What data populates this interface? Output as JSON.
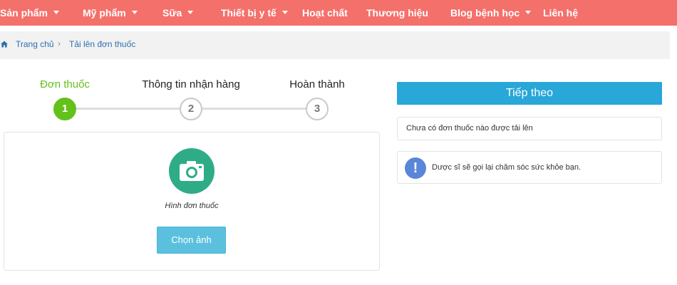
{
  "nav": {
    "items": [
      {
        "label": "Sản phẩm",
        "has_dropdown": true
      },
      {
        "label": "Mỹ phẩm",
        "has_dropdown": true
      },
      {
        "label": "Sữa",
        "has_dropdown": true
      },
      {
        "label": "Thiết bị y tế",
        "has_dropdown": true
      },
      {
        "label": "Hoạt chất",
        "has_dropdown": false
      },
      {
        "label": "Thương hiệu",
        "has_dropdown": false
      },
      {
        "label": "Blog bệnh học",
        "has_dropdown": true
      },
      {
        "label": "Liên hệ",
        "has_dropdown": false
      }
    ]
  },
  "breadcrumb": {
    "home_icon": "home-icon",
    "home_label": "Trang chủ",
    "separator": "›",
    "current_label": "Tải lên đơn thuốc"
  },
  "stepper": {
    "steps": [
      {
        "label": "Đơn thuốc",
        "number": "1",
        "active": true
      },
      {
        "label": "Thông tin nhận hàng",
        "number": "2",
        "active": false
      },
      {
        "label": "Hoàn thành",
        "number": "3",
        "active": false
      }
    ]
  },
  "upload": {
    "icon": "camera-icon",
    "caption": "Hình đơn thuốc",
    "choose_button": "Chọn ảnh"
  },
  "sidebar": {
    "next_button": "Tiếp theo",
    "empty_message": "Chưa có đơn thuốc nào được tải lên",
    "notice_icon": "exclamation-icon",
    "notice_symbol": "!",
    "notice_message": "Dược sĩ sẽ gọi lại chăm sóc sức khỏe bạn."
  },
  "colors": {
    "nav_bg": "#f4706a",
    "step_active": "#63c11a",
    "camera_bg": "#2eac87",
    "choose_button_bg": "#5bc0de",
    "next_button_bg": "#28a7d8",
    "notice_icon_bg": "#5a86d9"
  }
}
